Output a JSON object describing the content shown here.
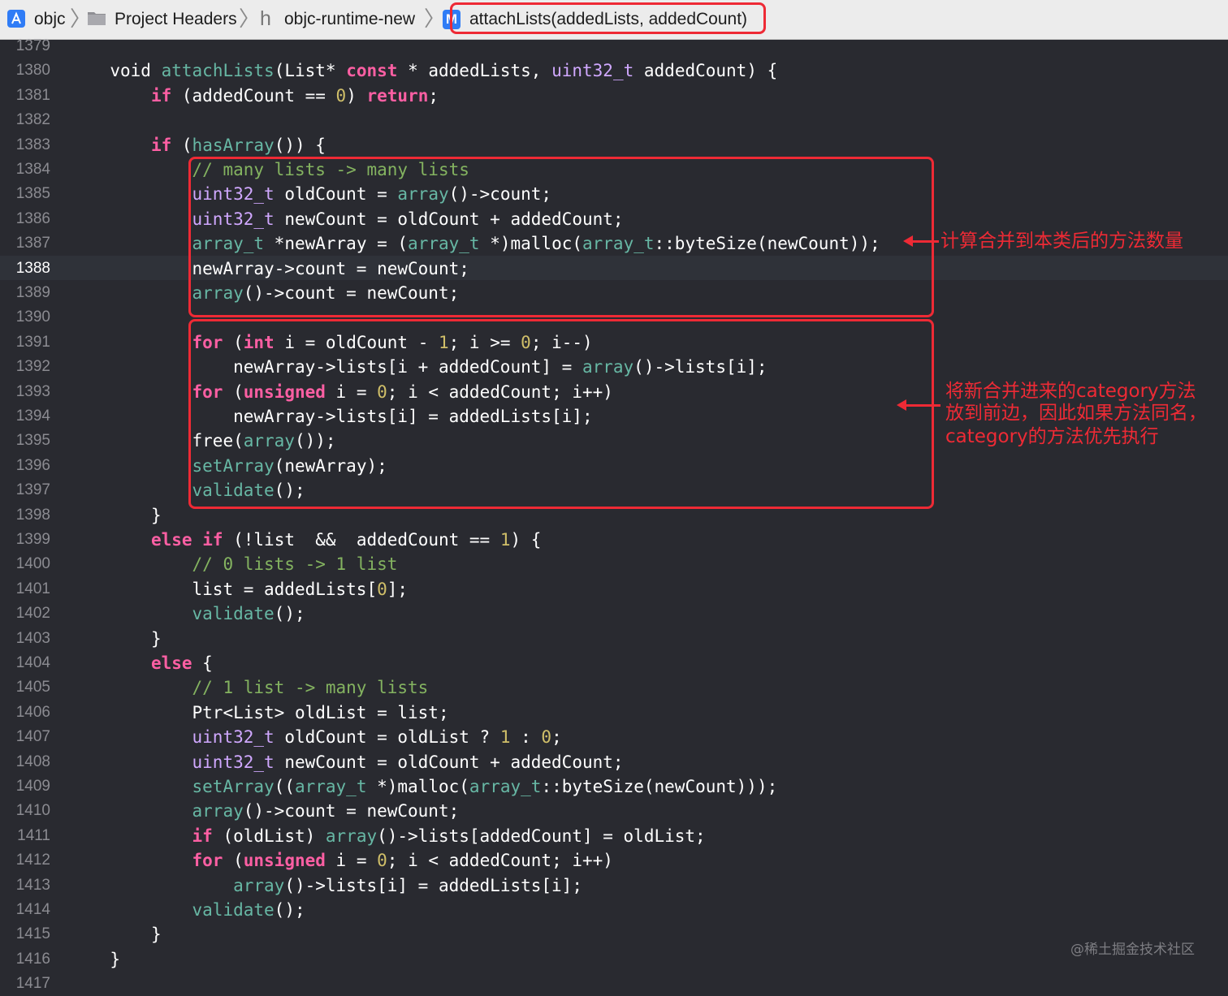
{
  "breadcrumb": {
    "items": [
      "objc",
      "Project Headers",
      "objc-runtime-new",
      "attachLists(addedLists, addedCount)"
    ],
    "icons": [
      "app-icon",
      "folder-icon",
      "header-file-icon",
      "method-icon"
    ],
    "method_icon_glyph": "M"
  },
  "editor": {
    "current_line": "1388",
    "lines": [
      {
        "n": "1379",
        "tokens": []
      },
      {
        "n": "1380",
        "tokens": [
          [
            "    ",
            "pl"
          ],
          [
            "void",
            "pl"
          ],
          [
            " ",
            "pl"
          ],
          [
            "attachLists",
            "fn"
          ],
          [
            "(List",
            "pl"
          ],
          [
            "*",
            "pl"
          ],
          [
            " ",
            "pl"
          ],
          [
            "const",
            "kw"
          ],
          [
            " * addedLists, ",
            "pl"
          ],
          [
            "uint32_t",
            "type"
          ],
          [
            " addedCount) {",
            "pl"
          ]
        ]
      },
      {
        "n": "1381",
        "tokens": [
          [
            "        ",
            "pl"
          ],
          [
            "if",
            "kw"
          ],
          [
            " (addedCount == ",
            "pl"
          ],
          [
            "0",
            "num"
          ],
          [
            ") ",
            "pl"
          ],
          [
            "return",
            "kw"
          ],
          [
            ";",
            "pl"
          ]
        ]
      },
      {
        "n": "1382",
        "tokens": []
      },
      {
        "n": "1383",
        "tokens": [
          [
            "        ",
            "pl"
          ],
          [
            "if",
            "kw"
          ],
          [
            " (",
            "pl"
          ],
          [
            "hasArray",
            "fn"
          ],
          [
            "()) {",
            "pl"
          ]
        ]
      },
      {
        "n": "1384",
        "tokens": [
          [
            "            ",
            "pl"
          ],
          [
            "// many lists -> many lists",
            "cmg"
          ]
        ]
      },
      {
        "n": "1385",
        "tokens": [
          [
            "            ",
            "pl"
          ],
          [
            "uint32_t",
            "type"
          ],
          [
            " oldCount = ",
            "pl"
          ],
          [
            "array",
            "fn"
          ],
          [
            "()->count;",
            "pl"
          ]
        ]
      },
      {
        "n": "1386",
        "tokens": [
          [
            "            ",
            "pl"
          ],
          [
            "uint32_t",
            "type"
          ],
          [
            " newCount = oldCount + addedCount;",
            "pl"
          ]
        ]
      },
      {
        "n": "1387",
        "tokens": [
          [
            "            ",
            "pl"
          ],
          [
            "array_t",
            "fn"
          ],
          [
            " *newArray = (",
            "pl"
          ],
          [
            "array_t",
            "fn"
          ],
          [
            " *)malloc(",
            "pl"
          ],
          [
            "array_t",
            "fn"
          ],
          [
            "::byteSize(newCount));",
            "pl"
          ]
        ]
      },
      {
        "n": "1388",
        "tokens": [
          [
            "            newArray->count = newCount;",
            "pl"
          ]
        ]
      },
      {
        "n": "1389",
        "tokens": [
          [
            "            ",
            "pl"
          ],
          [
            "array",
            "fn"
          ],
          [
            "()->count = newCount;",
            "pl"
          ]
        ]
      },
      {
        "n": "1390",
        "tokens": []
      },
      {
        "n": "1391",
        "tokens": [
          [
            "            ",
            "pl"
          ],
          [
            "for",
            "kw"
          ],
          [
            " (",
            "pl"
          ],
          [
            "int",
            "kw"
          ],
          [
            " i = oldCount - ",
            "pl"
          ],
          [
            "1",
            "num"
          ],
          [
            "; i >= ",
            "pl"
          ],
          [
            "0",
            "num"
          ],
          [
            "; i--)",
            "pl"
          ]
        ]
      },
      {
        "n": "1392",
        "tokens": [
          [
            "                newArray->lists[i + addedCount] = ",
            "pl"
          ],
          [
            "array",
            "fn"
          ],
          [
            "()->lists[i];",
            "pl"
          ]
        ]
      },
      {
        "n": "1393",
        "tokens": [
          [
            "            ",
            "pl"
          ],
          [
            "for",
            "kw"
          ],
          [
            " (",
            "pl"
          ],
          [
            "unsigned",
            "kw"
          ],
          [
            " i = ",
            "pl"
          ],
          [
            "0",
            "num"
          ],
          [
            "; i < addedCount; i++)",
            "pl"
          ]
        ]
      },
      {
        "n": "1394",
        "tokens": [
          [
            "                newArray->lists[i] = addedLists[i];",
            "pl"
          ]
        ]
      },
      {
        "n": "1395",
        "tokens": [
          [
            "            free(",
            "pl"
          ],
          [
            "array",
            "fn"
          ],
          [
            "());",
            "pl"
          ]
        ]
      },
      {
        "n": "1396",
        "tokens": [
          [
            "            ",
            "pl"
          ],
          [
            "setArray",
            "fn"
          ],
          [
            "(newArray);",
            "pl"
          ]
        ]
      },
      {
        "n": "1397",
        "tokens": [
          [
            "            ",
            "pl"
          ],
          [
            "validate",
            "fn"
          ],
          [
            "();",
            "pl"
          ]
        ]
      },
      {
        "n": "1398",
        "tokens": [
          [
            "        }",
            "pl"
          ]
        ]
      },
      {
        "n": "1399",
        "tokens": [
          [
            "        ",
            "pl"
          ],
          [
            "else",
            "kw"
          ],
          [
            " ",
            "pl"
          ],
          [
            "if",
            "kw"
          ],
          [
            " (!list  &&  addedCount == ",
            "pl"
          ],
          [
            "1",
            "num"
          ],
          [
            ") {",
            "pl"
          ]
        ]
      },
      {
        "n": "1400",
        "tokens": [
          [
            "            ",
            "pl"
          ],
          [
            "// 0 lists -> 1 list",
            "cmg"
          ]
        ]
      },
      {
        "n": "1401",
        "tokens": [
          [
            "            list = addedLists[",
            "pl"
          ],
          [
            "0",
            "num"
          ],
          [
            "];",
            "pl"
          ]
        ]
      },
      {
        "n": "1402",
        "tokens": [
          [
            "            ",
            "pl"
          ],
          [
            "validate",
            "fn"
          ],
          [
            "();",
            "pl"
          ]
        ]
      },
      {
        "n": "1403",
        "tokens": [
          [
            "        }",
            "pl"
          ]
        ]
      },
      {
        "n": "1404",
        "tokens": [
          [
            "        ",
            "pl"
          ],
          [
            "else",
            "kw"
          ],
          [
            " {",
            "pl"
          ]
        ]
      },
      {
        "n": "1405",
        "tokens": [
          [
            "            ",
            "pl"
          ],
          [
            "// 1 list -> many lists",
            "cmg"
          ]
        ]
      },
      {
        "n": "1406",
        "tokens": [
          [
            "            Ptr<List> oldList = list;",
            "pl"
          ]
        ]
      },
      {
        "n": "1407",
        "tokens": [
          [
            "            ",
            "pl"
          ],
          [
            "uint32_t",
            "type"
          ],
          [
            " oldCount = oldList ? ",
            "pl"
          ],
          [
            "1",
            "num"
          ],
          [
            " : ",
            "pl"
          ],
          [
            "0",
            "num"
          ],
          [
            ";",
            "pl"
          ]
        ]
      },
      {
        "n": "1408",
        "tokens": [
          [
            "            ",
            "pl"
          ],
          [
            "uint32_t",
            "type"
          ],
          [
            " newCount = oldCount + addedCount;",
            "pl"
          ]
        ]
      },
      {
        "n": "1409",
        "tokens": [
          [
            "            ",
            "pl"
          ],
          [
            "setArray",
            "fn"
          ],
          [
            "((",
            "pl"
          ],
          [
            "array_t",
            "fn"
          ],
          [
            " *)malloc(",
            "pl"
          ],
          [
            "array_t",
            "fn"
          ],
          [
            "::byteSize(newCount)));",
            "pl"
          ]
        ]
      },
      {
        "n": "1410",
        "tokens": [
          [
            "            ",
            "pl"
          ],
          [
            "array",
            "fn"
          ],
          [
            "()->count = newCount;",
            "pl"
          ]
        ]
      },
      {
        "n": "1411",
        "tokens": [
          [
            "            ",
            "pl"
          ],
          [
            "if",
            "kw"
          ],
          [
            " (oldList) ",
            "pl"
          ],
          [
            "array",
            "fn"
          ],
          [
            "()->lists[addedCount] = oldList;",
            "pl"
          ]
        ]
      },
      {
        "n": "1412",
        "tokens": [
          [
            "            ",
            "pl"
          ],
          [
            "for",
            "kw"
          ],
          [
            " (",
            "pl"
          ],
          [
            "unsigned",
            "kw"
          ],
          [
            " i = ",
            "pl"
          ],
          [
            "0",
            "num"
          ],
          [
            "; i < addedCount; i++)",
            "pl"
          ]
        ]
      },
      {
        "n": "1413",
        "tokens": [
          [
            "                ",
            "pl"
          ],
          [
            "array",
            "fn"
          ],
          [
            "()->lists[i] = addedLists[i];",
            "pl"
          ]
        ]
      },
      {
        "n": "1414",
        "tokens": [
          [
            "            ",
            "pl"
          ],
          [
            "validate",
            "fn"
          ],
          [
            "();",
            "pl"
          ]
        ]
      },
      {
        "n": "1415",
        "tokens": [
          [
            "        }",
            "pl"
          ]
        ]
      },
      {
        "n": "1416",
        "tokens": [
          [
            "    }",
            "pl"
          ]
        ]
      },
      {
        "n": "1417",
        "tokens": []
      }
    ]
  },
  "annotations": {
    "note1": "计算合并到本类后的方法数量",
    "note2_lines": [
      "将新合并进来的category方法",
      "放到前边，因此如果方法同名，",
      "category的方法优先执行"
    ]
  },
  "watermark": "@稀土掘金技术社区",
  "colors": {
    "background": "#292a30",
    "keyword": "#fc5fa3",
    "type": "#d0a8ff",
    "function": "#67b7a4",
    "number": "#d0bf69",
    "comment": "#84b360",
    "annotation_red": "#ee2a35"
  }
}
